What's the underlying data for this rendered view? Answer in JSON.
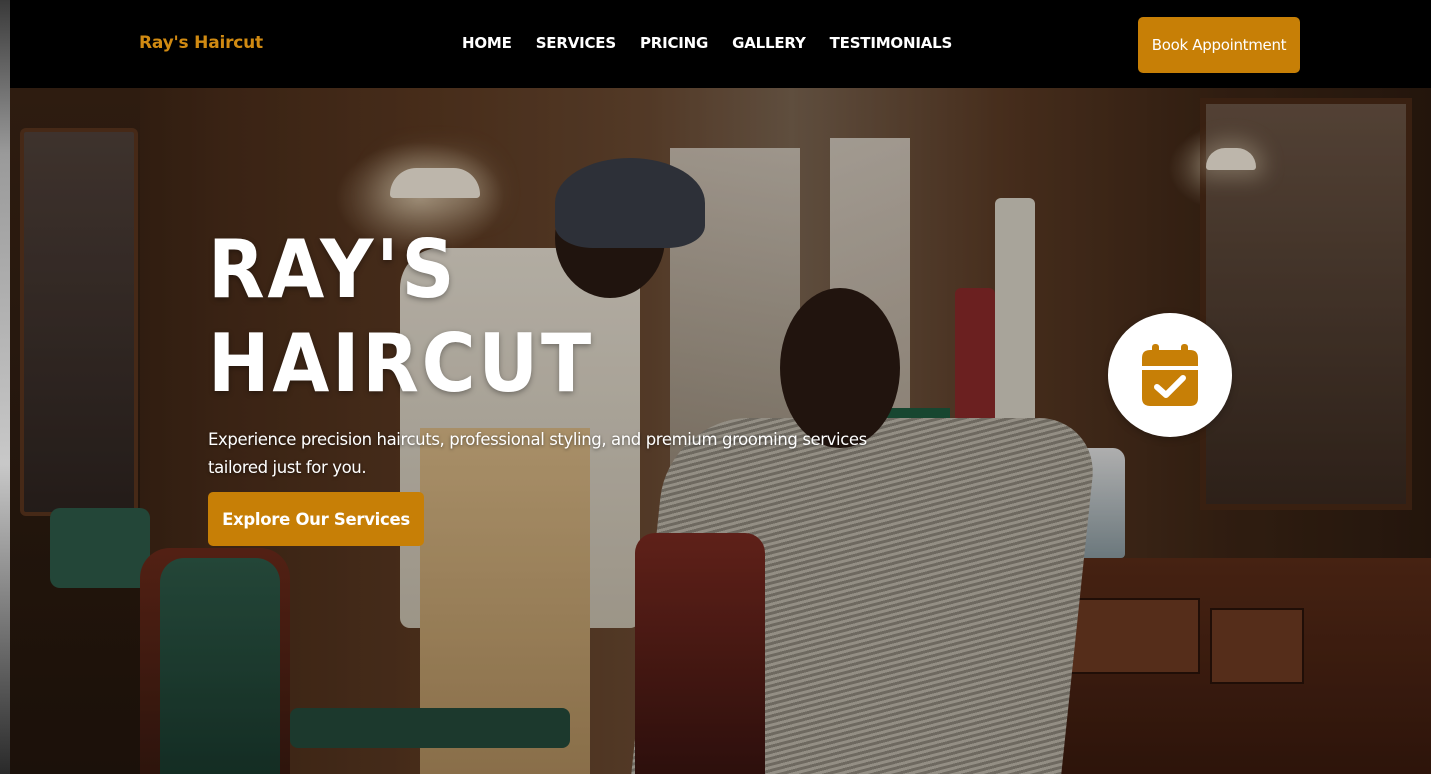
{
  "nav": {
    "brand": "Ray's Haircut",
    "links": [
      "HOME",
      "SERVICES",
      "PRICING",
      "GALLERY",
      "TESTIMONIALS"
    ],
    "cta_label": "Book Appointment"
  },
  "hero": {
    "title_line1": "RAY'S",
    "title_line2": "HAIRCUT",
    "subtitle": "Experience precision haircuts, professional styling, and premium grooming services tailored just for you.",
    "button_label": "Explore Our Services",
    "floating_icon": "calendar-check-icon"
  },
  "colors": {
    "accent": "#c77f06",
    "brand_text": "#d08a12",
    "nav_bg": "#000000",
    "text_light": "#ffffff"
  }
}
